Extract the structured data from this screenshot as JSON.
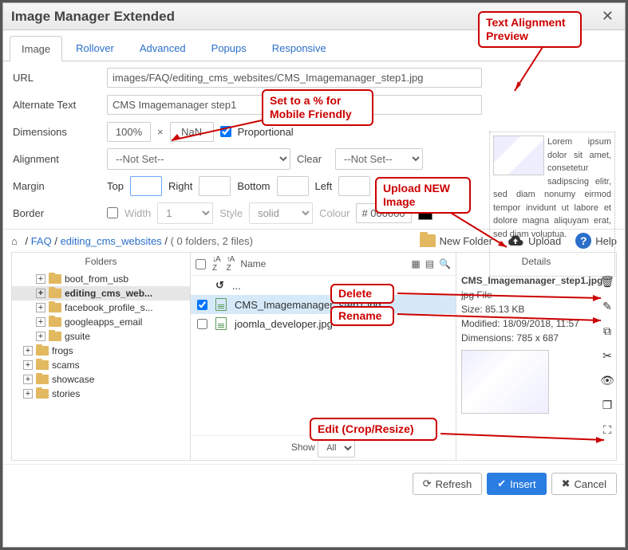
{
  "window": {
    "title": "Image Manager Extended"
  },
  "tabs": [
    "Image",
    "Rollover",
    "Advanced",
    "Popups",
    "Responsive"
  ],
  "activeTab": 0,
  "form": {
    "url_label": "URL",
    "url_value": "images/FAQ/editing_cms_websites/CMS_Imagemanager_step1.jpg",
    "alt_label": "Alternate Text",
    "alt_value": "CMS Imagemanager step1",
    "dim_label": "Dimensions",
    "dim_w": "100%",
    "dim_lock": "×",
    "dim_h": "NaN",
    "dim_proportional": "Proportional",
    "align_label": "Alignment",
    "align_value": "--Not Set--",
    "clear_label": "Clear",
    "clear_value": "--Not Set--",
    "margin_label": "Margin",
    "margin_top": "Top",
    "margin_right": "Right",
    "margin_bottom": "Bottom",
    "margin_left": "Left",
    "border_label": "Border",
    "border_width": "Width",
    "border_width_val": "1",
    "border_style": "Style",
    "border_style_val": "solid",
    "border_colour": "Colour",
    "border_colour_val": "# 000000"
  },
  "preview": {
    "text": "Lorem ipsum dolor sit amet, consetetur sadipscing elitr, sed diam nonumy eirmod tempor invidunt ut labore et dolore magna aliquyam erat, sed diam voluptua."
  },
  "breadcrumb": {
    "seg1": "FAQ",
    "seg2": "editing_cms_websites",
    "status": "( 0 folders, 2 files)"
  },
  "toolbar": {
    "new_folder": "New Folder",
    "upload": "Upload",
    "help": "Help"
  },
  "folders_header": "Folders",
  "folders": [
    {
      "name": "boot_from_usb",
      "level": 2,
      "sel": false
    },
    {
      "name": "editing_cms_web...",
      "level": 2,
      "sel": true
    },
    {
      "name": "facebook_profile_s...",
      "level": 2,
      "sel": false
    },
    {
      "name": "googleapps_email",
      "level": 2,
      "sel": false
    },
    {
      "name": "gsuite",
      "level": 2,
      "sel": false
    },
    {
      "name": "frogs",
      "level": 1,
      "sel": false
    },
    {
      "name": "scams",
      "level": 1,
      "sel": false
    },
    {
      "name": "showcase",
      "level": 1,
      "sel": false
    },
    {
      "name": "stories",
      "level": 1,
      "sel": false
    }
  ],
  "files_header": {
    "name": "Name",
    "details": "Details"
  },
  "files": [
    {
      "name": "...",
      "up": true,
      "sel": false
    },
    {
      "name": "CMS_Imagemanager_step1.jpg",
      "up": false,
      "sel": true
    },
    {
      "name": "joomla_developer.jpg",
      "up": false,
      "sel": false
    }
  ],
  "details": {
    "name": "CMS_Imagemanager_step1.jpg",
    "type": "jpg File",
    "size": "Size: 85.13 KB",
    "modified": "Modified: 18/09/2018, 11:57",
    "dimensions": "Dimensions: 785 x 687"
  },
  "show": {
    "label": "Show",
    "value": "All"
  },
  "footer": {
    "refresh": "Refresh",
    "insert": "Insert",
    "cancel": "Cancel"
  },
  "annotations": {
    "text_alignment": "Text Alignment Preview",
    "mobile": "Set to a % for Mobile Friendly",
    "upload": "Upload NEW Image",
    "delete": "Delete",
    "rename": "Rename",
    "edit": "Edit (Crop/Resize)"
  }
}
